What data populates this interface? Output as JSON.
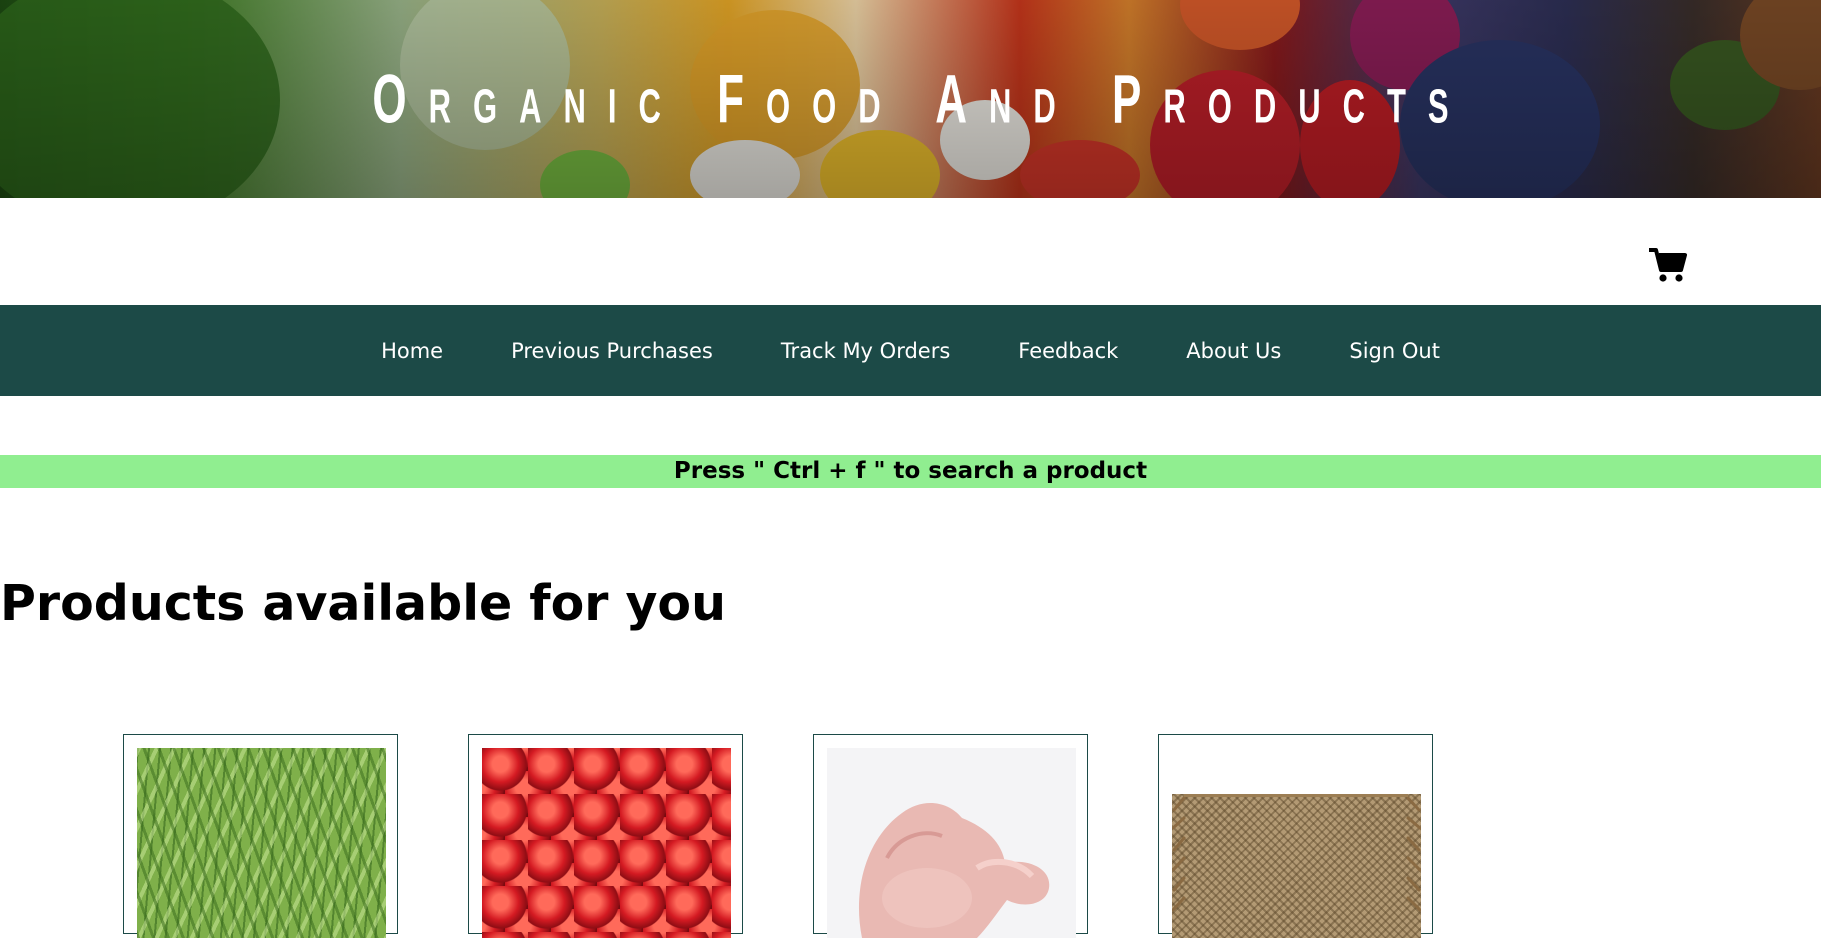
{
  "banner": {
    "title": "Organic Food And Products"
  },
  "header": {
    "cart_icon": "shopping-cart-icon"
  },
  "nav": {
    "items": [
      {
        "label": "Home"
      },
      {
        "label": "Previous Purchases"
      },
      {
        "label": "Track My Orders"
      },
      {
        "label": "Feedback"
      },
      {
        "label": "About Us"
      },
      {
        "label": "Sign Out"
      }
    ],
    "background": "#1c4a47"
  },
  "search_hint": {
    "text": "Press \" Ctrl + f \" to search a product",
    "background": "#90ee90"
  },
  "products": {
    "heading": "Products available for you",
    "items": [
      {
        "image": "green-beans"
      },
      {
        "image": "red-apples"
      },
      {
        "image": "raw-chicken"
      },
      {
        "image": "jute-mat"
      }
    ]
  }
}
